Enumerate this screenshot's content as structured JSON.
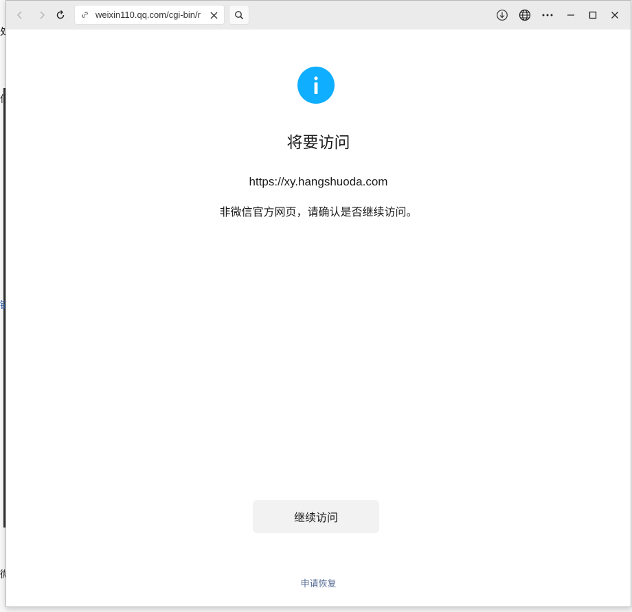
{
  "browser": {
    "address_url": "weixin110.qq.com/cgi-bin/r",
    "icons": {
      "back": "back-icon",
      "forward": "forward-icon",
      "refresh": "refresh-icon",
      "link": "link-icon",
      "clear": "close-icon",
      "search": "search-icon",
      "download": "download-icon",
      "globe": "globe-icon",
      "more": "more-icon",
      "minimize": "minimize-icon",
      "maximize": "maximize-icon",
      "close": "window-close-icon"
    }
  },
  "background_fragments": [
    "处",
    "信",
    "链",
    "微"
  ],
  "page": {
    "title": "将要访问",
    "target_url": "https://xy.hangshuoda.com",
    "warning": "非微信官方网页，请确认是否继续访问。",
    "continue_button": "继续访问",
    "recover_link": "申请恢复",
    "accent_color": "#10aeff",
    "link_color": "#576b95"
  }
}
